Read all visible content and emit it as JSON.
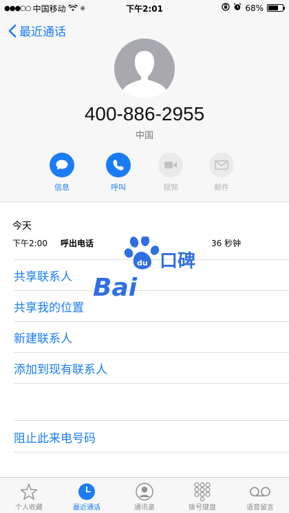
{
  "status_bar": {
    "carrier": "中国移动",
    "time": "下午2:01",
    "battery": "68%",
    "battery_level": 0.68
  },
  "header": {
    "back_label": "最近通话",
    "phone_number": "400-886-2955",
    "region": "中国"
  },
  "actions": [
    {
      "label": "信息",
      "icon": "message-icon",
      "enabled": true
    },
    {
      "label": "呼叫",
      "icon": "phone-icon",
      "enabled": true
    },
    {
      "label": "视频",
      "icon": "video-icon",
      "enabled": false
    },
    {
      "label": "邮件",
      "icon": "mail-icon",
      "enabled": false
    }
  ],
  "recent": {
    "day": "今天",
    "call": {
      "time": "下午2:00",
      "type": "呼出电话",
      "duration": "36 秒钟"
    }
  },
  "menu": {
    "share_contact": "共享联系人",
    "share_location": "共享我的位置",
    "new_contact": "新建联系人",
    "add_existing": "添加到现有联系人",
    "block": "阻止此来电号码"
  },
  "watermark": {
    "text": "Bai",
    "brand": "du",
    "suffix": "口碑"
  },
  "tabs": [
    {
      "label": "个人收藏",
      "icon": "star-icon",
      "active": false
    },
    {
      "label": "最近通话",
      "icon": "clock-icon",
      "active": true
    },
    {
      "label": "通讯录",
      "icon": "contacts-icon",
      "active": false
    },
    {
      "label": "拨号键盘",
      "icon": "keypad-icon",
      "active": false
    },
    {
      "label": "语音留言",
      "icon": "voicemail-icon",
      "active": false
    }
  ],
  "colors": {
    "accent": "#1a7cf5",
    "disabled": "#b4b4b4",
    "watermark": "#2f6fe0"
  }
}
